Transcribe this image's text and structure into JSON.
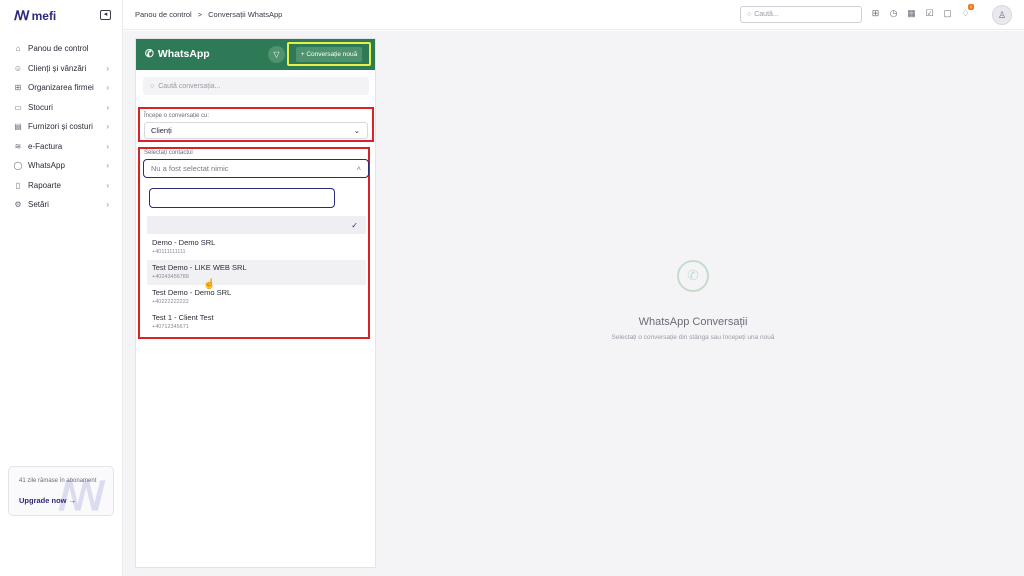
{
  "brand": {
    "name": "mefi",
    "logo_mark": "m"
  },
  "sidebar": {
    "items": [
      {
        "icon": "home-icon",
        "glyph": "⌂",
        "label": "Panou de control",
        "has_chevron": false
      },
      {
        "icon": "users-icon",
        "glyph": "☺",
        "label": "Clienți și vânzări",
        "has_chevron": true
      },
      {
        "icon": "org-icon",
        "glyph": "⊞",
        "label": "Organizarea firmei",
        "has_chevron": true
      },
      {
        "icon": "box-icon",
        "glyph": "▭",
        "label": "Stocuri",
        "has_chevron": true
      },
      {
        "icon": "supplier-icon",
        "glyph": "▤",
        "label": "Furnizori și costuri",
        "has_chevron": true
      },
      {
        "icon": "invoice-icon",
        "glyph": "≋",
        "label": "e-Factura",
        "has_chevron": true
      },
      {
        "icon": "chat-icon",
        "glyph": "◯",
        "label": "WhatsApp",
        "has_chevron": true
      },
      {
        "icon": "report-icon",
        "glyph": "▯",
        "label": "Rapoarte",
        "has_chevron": true
      },
      {
        "icon": "gear-icon",
        "glyph": "⚙",
        "label": "Setări",
        "has_chevron": true
      }
    ],
    "chevron": "›",
    "upgrade": {
      "text": "41 zile rămase în abonament",
      "link": "Upgrade now →"
    }
  },
  "topbar": {
    "breadcrumb": [
      "Panou de control",
      "Conversații WhatsApp"
    ],
    "breadcrumb_sep": ">",
    "search_placeholder": "Caută...",
    "notification_count": "1"
  },
  "whatsapp_panel": {
    "title": "WhatsApp",
    "new_conversation_label": "+ Conversație nouă",
    "search_placeholder": "Caută conversația..."
  },
  "start_with": {
    "label": "Începe o conversație cu:",
    "value": "Clienți"
  },
  "contact_select": {
    "label": "Selectați contactul",
    "placeholder": "Nu a fost selectat nimic",
    "options": [
      {
        "name": "Demo - Demo SRL",
        "phone": "+40111111111"
      },
      {
        "name": "Test Demo - LIKE WEB SRL",
        "phone": "+40243456789"
      },
      {
        "name": "Test Demo - Demo SRL",
        "phone": "+40222222222"
      },
      {
        "name": "Test 1 - Client Test",
        "phone": "+40712345671"
      }
    ]
  },
  "empty_state": {
    "title": "WhatsApp Conversații",
    "subtitle": "Selectați o conversație din stânga sau începeți una nouă"
  },
  "colors": {
    "whatsapp_green": "#2f7a56",
    "brand_navy": "#2d2a7a",
    "highlight_red": "#d8222a",
    "highlight_yellow": "#e6f04a"
  }
}
